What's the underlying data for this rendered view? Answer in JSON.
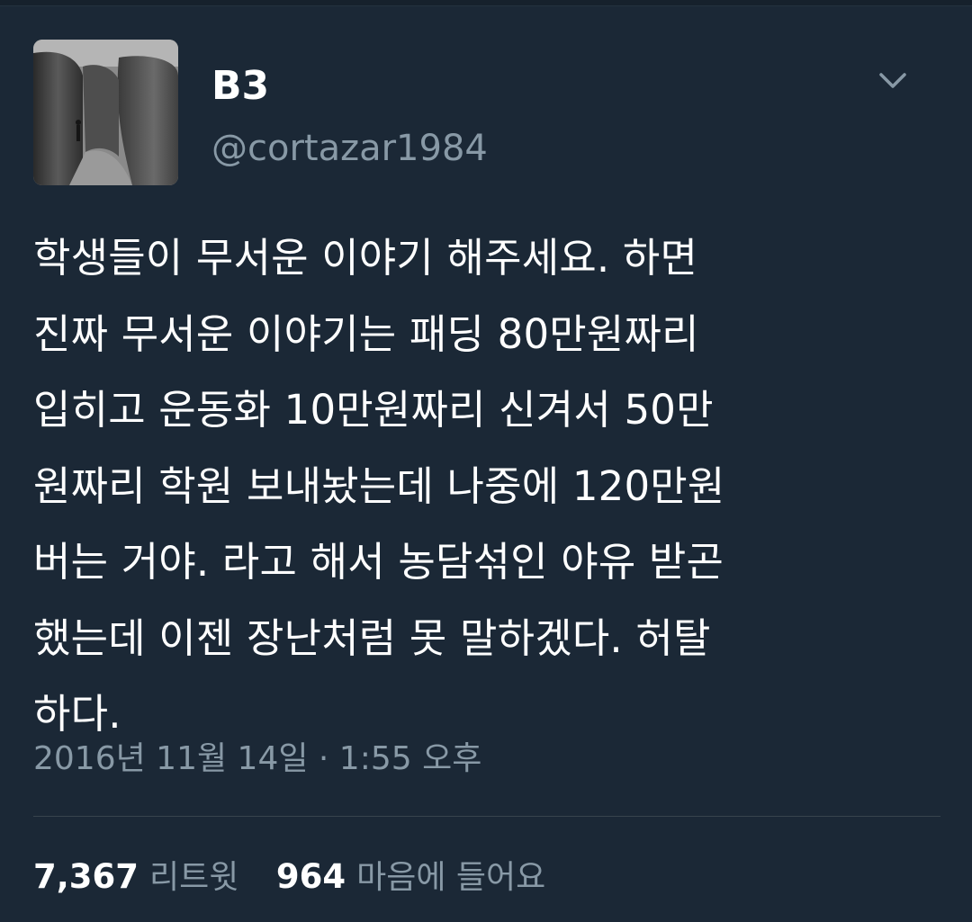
{
  "profile": {
    "display_name": "B3",
    "handle": "@cortazar1984"
  },
  "icons": {
    "avatar": "avatar-photo",
    "caret": "chevron-down-icon"
  },
  "tweet": {
    "lines": [
      "학생들이 무서운 이야기 해주세요. 하면",
      "진짜 무서운 이야기는 패딩 80만원짜리",
      "입히고 운동화 10만원짜리 신겨서 50만",
      "원짜리 학원 보내놨는데 나중에 120만원",
      "버는 거야. 라고 해서 농담섞인 야유 받곤",
      "했는데 이젠 장난처럼 못 말하겠다. 허탈",
      "하다."
    ],
    "timestamp": "2016년 11월 14일 · 1:55 오후"
  },
  "stats": {
    "retweets_count": "7,367",
    "retweets_label": "리트윗",
    "likes_count": "964",
    "likes_label": "마음에 들어요"
  },
  "colors": {
    "background": "#1b2836",
    "text": "#ffffff",
    "secondary_text": "#8899a6",
    "divider": "#38444d"
  }
}
